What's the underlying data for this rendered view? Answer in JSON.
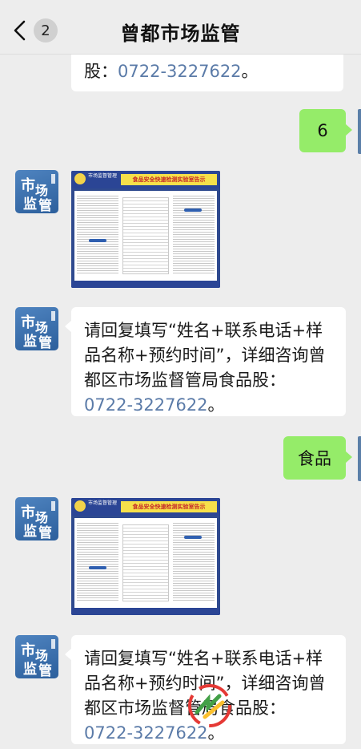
{
  "header": {
    "title": "曾都市场监管",
    "back_icon": "chevron-left-icon",
    "unread_count": "2"
  },
  "colors": {
    "background": "#ededed",
    "outgoing_bubble": "#95ec69",
    "incoming_bubble": "#ffffff",
    "link_phone": "#5b7ba8"
  },
  "messages": [
    {
      "from": "official",
      "type": "text",
      "partial": true,
      "prefix": "股：",
      "phone": "0722-3227622",
      "suffix": "。"
    },
    {
      "from": "me",
      "type": "text",
      "text": "6"
    },
    {
      "from": "official",
      "type": "image",
      "poster_org": "市场监督管理",
      "poster_title": "食品安全快速检测实验室告示"
    },
    {
      "from": "official",
      "type": "text",
      "prefix": "请回复填写“姓名+联系电话+样品名称+预约时间”，详细咨询曾都区市场监督管局食品股：",
      "phone": "0722-3227622",
      "suffix": "。"
    },
    {
      "from": "me",
      "type": "text",
      "text": "食品"
    },
    {
      "from": "official",
      "type": "image",
      "poster_org": "市场监督管理",
      "poster_title": "食品安全快速检测实验室告示"
    },
    {
      "from": "official",
      "type": "text",
      "prefix": "请回复填写“姓名+联系电话+样品名称+预约时间”，详细咨询曾都区市场监督管局食品股：",
      "phone": "0722-3227622",
      "suffix": "。"
    }
  ],
  "avatar": {
    "char1": "市",
    "char2": "场",
    "char3": "监",
    "char4": "管"
  }
}
